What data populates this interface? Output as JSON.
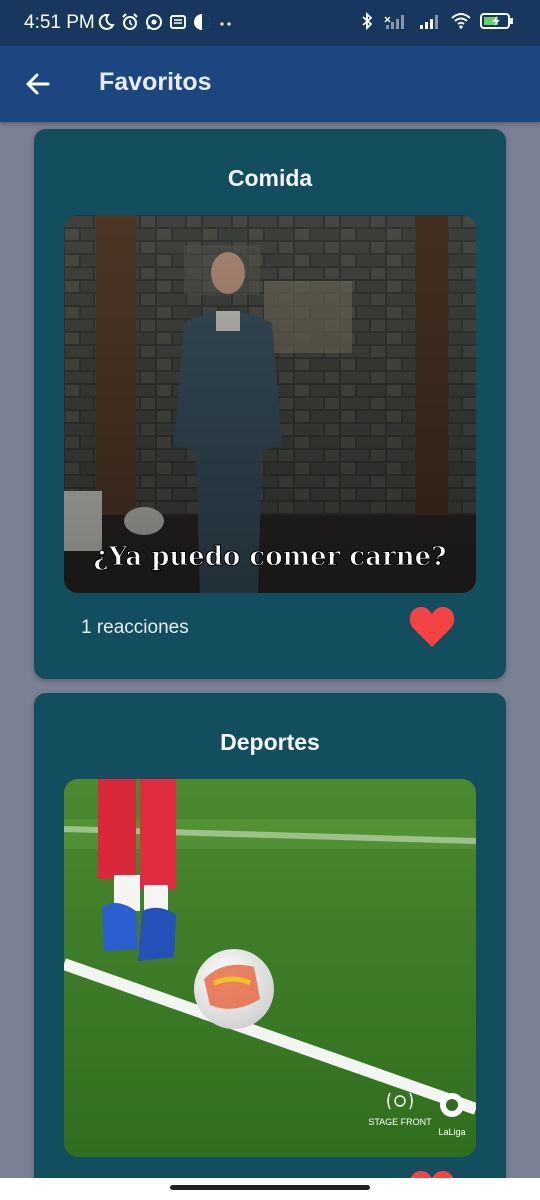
{
  "status_bar": {
    "time": "4:51 PM",
    "left_icons": [
      "moon-icon",
      "alarm-icon",
      "whatsapp-icon",
      "news-icon",
      "circle-app-icon",
      "more-dots-icon"
    ],
    "right_icons": [
      "bluetooth-icon",
      "signal-icon",
      "signal-icon",
      "wifi-icon",
      "battery-charging-icon"
    ]
  },
  "app_bar": {
    "title": "Favoritos",
    "back_icon": "arrow-left-icon",
    "color": "#1b4680"
  },
  "favorites": [
    {
      "title": "Comida",
      "caption": "¿Ya puedo comer carne?",
      "reactions": "1 reacciones",
      "liked": true
    },
    {
      "title": "Deportes",
      "image_text": [
        "STAGE FRONT",
        "LaLiga"
      ],
      "liked": true
    }
  ],
  "colors": {
    "background": "#7b8194",
    "card": "#134e5e",
    "heart": "#f44343",
    "status_bar": "#17375e"
  }
}
